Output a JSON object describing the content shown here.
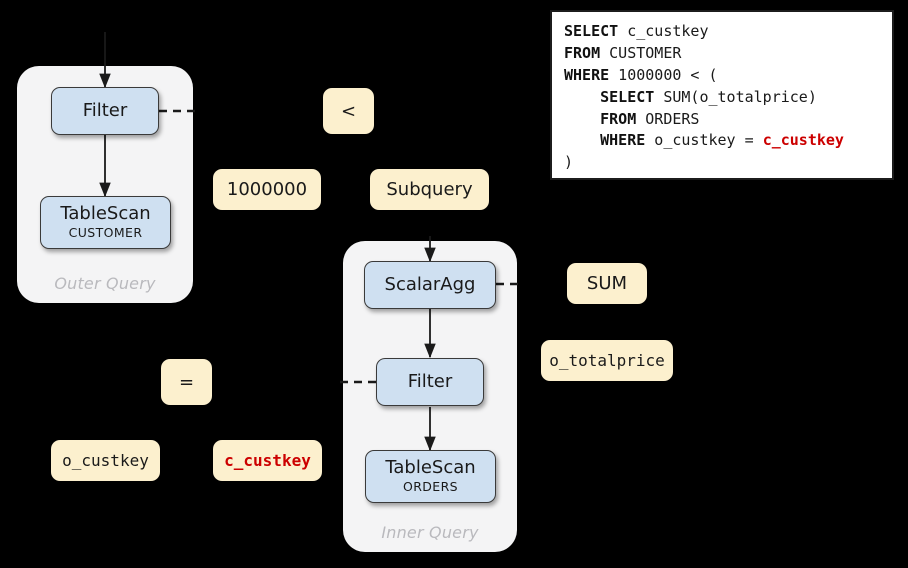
{
  "background_color": "#000000",
  "colors": {
    "operator_node_fill": "#cfe0f1",
    "operator_node_border": "#3a3a3a",
    "expression_node_fill": "#fcf0ce",
    "group_container_fill": "#f4f4f5",
    "correlated_column": "#cc0000",
    "group_label_text": "#b9b9bd",
    "sql_panel_background": "#ffffff",
    "sql_panel_border": "#1c1c1c"
  },
  "outer_query": {
    "label": "Outer Query",
    "nodes": [
      {
        "name": "filter",
        "title": "Filter",
        "subtitle": ""
      },
      {
        "name": "tablescan",
        "title": "TableScan",
        "subtitle": "CUSTOMER"
      }
    ]
  },
  "inner_query": {
    "label": "Inner Query",
    "nodes": [
      {
        "name": "scalaragg",
        "title": "ScalarAgg",
        "subtitle": ""
      },
      {
        "name": "filter",
        "title": "Filter",
        "subtitle": ""
      },
      {
        "name": "tablescan",
        "title": "TableScan",
        "subtitle": "ORDERS"
      }
    ]
  },
  "expressions": {
    "outer_predicate_operator": "<",
    "outer_predicate_left": "1000000",
    "outer_predicate_right": "Subquery",
    "aggregate_function": "SUM",
    "aggregate_argument": "o_totalprice",
    "join_predicate_operator": "=",
    "join_predicate_left": "o_custkey",
    "join_predicate_right": "c_custkey"
  },
  "sql": {
    "lines": [
      {
        "parts": [
          {
            "text": "SELECT",
            "kw": true
          },
          {
            "text": " c_custkey"
          }
        ]
      },
      {
        "parts": [
          {
            "text": "FROM",
            "kw": true
          },
          {
            "text": " CUSTOMER"
          }
        ]
      },
      {
        "parts": [
          {
            "text": "WHERE",
            "kw": true
          },
          {
            "text": " 1000000 < ("
          }
        ]
      },
      {
        "parts": [
          {
            "text": "    "
          },
          {
            "text": "SELECT",
            "kw": true
          },
          {
            "text": " SUM(o_totalprice)"
          }
        ]
      },
      {
        "parts": [
          {
            "text": "    "
          },
          {
            "text": "FROM",
            "kw": true
          },
          {
            "text": " ORDERS"
          }
        ]
      },
      {
        "parts": [
          {
            "text": "    "
          },
          {
            "text": "WHERE",
            "kw": true
          },
          {
            "text": " o_custkey = "
          },
          {
            "text": "c_custkey",
            "corr": true
          }
        ]
      },
      {
        "parts": [
          {
            "text": ")"
          }
        ]
      }
    ]
  }
}
